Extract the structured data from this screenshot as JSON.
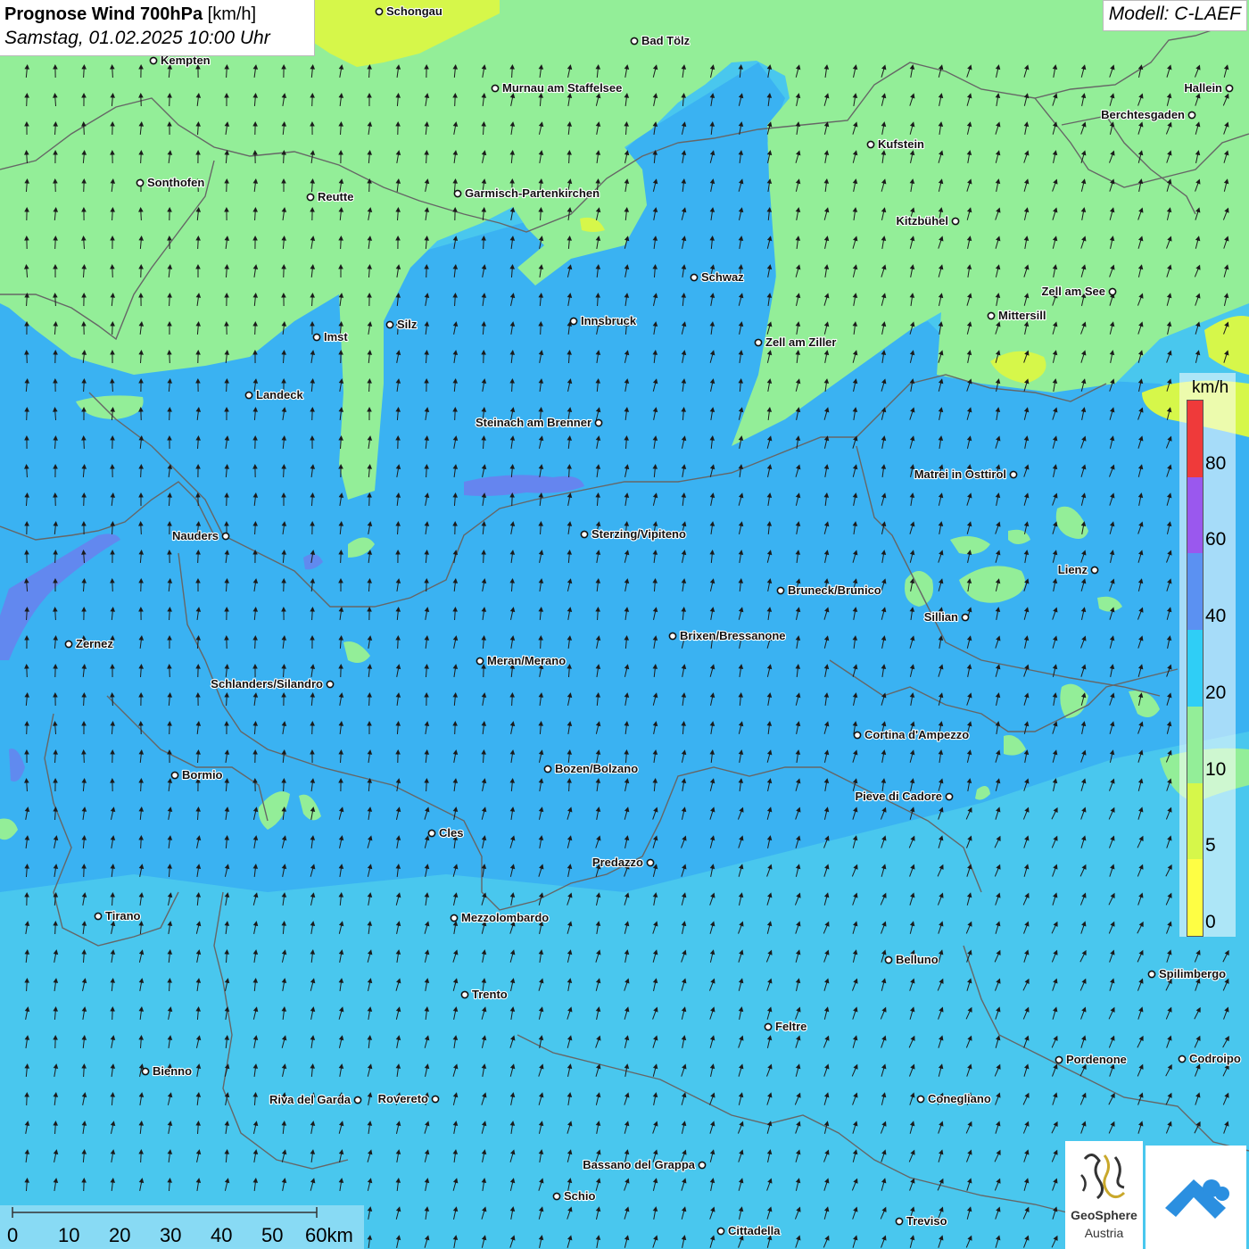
{
  "header": {
    "title": "Prognose Wind 700hPa",
    "unit": "[km/h]",
    "datetime": "Samstag, 01.02.2025 10:00 Uhr",
    "model": "Modell: C-LAEF"
  },
  "legend": {
    "unit": "km/h",
    "bins": [
      {
        "label": "0",
        "color": "#fefe44"
      },
      {
        "label": "5",
        "color": "#d6f74a"
      },
      {
        "label": "10",
        "color": "#93ee98"
      },
      {
        "label": "20",
        "color": "#2fcef6"
      },
      {
        "label": "40",
        "color": "#5b91f2"
      },
      {
        "label": "60",
        "color": "#9a58ee"
      },
      {
        "label": "80",
        "color": "#ef3a3a"
      }
    ]
  },
  "scale_bar": {
    "labels": [
      "0",
      "10",
      "20",
      "30",
      "40",
      "50",
      "60km"
    ]
  },
  "map": {
    "dominant_wind_direction": "from south / south-west",
    "colors": {
      "zone_green": "#93ee98",
      "zone_cyan": "#49c7ee",
      "zone_blue": "#3ab2f2",
      "zone_yellow": "#d6f74a",
      "zone_purple": "#6a80ee",
      "border": "#666666",
      "arrow": "#1b1b1b"
    },
    "cities": [
      {
        "name": "Schongau"
      },
      {
        "name": "Bad Tölz"
      },
      {
        "name": "Kempten"
      },
      {
        "name": "Murnau am Staffelsee"
      },
      {
        "name": "Hallein"
      },
      {
        "name": "Berchtesgaden"
      },
      {
        "name": "Kufstein"
      },
      {
        "name": "Sonthofen"
      },
      {
        "name": "Reutte"
      },
      {
        "name": "Garmisch-Partenkirchen"
      },
      {
        "name": "Kitzbühel"
      },
      {
        "name": "Schwaz"
      },
      {
        "name": "Zell am See"
      },
      {
        "name": "Mittersill"
      },
      {
        "name": "Silz"
      },
      {
        "name": "Innsbruck"
      },
      {
        "name": "Imst"
      },
      {
        "name": "Zell am Ziller"
      },
      {
        "name": "Landeck"
      },
      {
        "name": "Steinach am Brenner"
      },
      {
        "name": "Matrei in Osttirol"
      },
      {
        "name": "Nauders"
      },
      {
        "name": "Sterzing/Vipiteno"
      },
      {
        "name": "Lienz"
      },
      {
        "name": "Bruneck/Brunico"
      },
      {
        "name": "Sillian"
      },
      {
        "name": "Brixen/Bressanone"
      },
      {
        "name": "Zernez"
      },
      {
        "name": "Meran/Merano"
      },
      {
        "name": "Schlanders/Silandro"
      },
      {
        "name": "Cortina d'Ampezzo"
      },
      {
        "name": "Bozen/Bolzano"
      },
      {
        "name": "Bormio"
      },
      {
        "name": "Pieve di Cadore"
      },
      {
        "name": "Cles"
      },
      {
        "name": "Predazzo"
      },
      {
        "name": "Tirano"
      },
      {
        "name": "Mezzolombardo"
      },
      {
        "name": "Belluno"
      },
      {
        "name": "Spilimbergo"
      },
      {
        "name": "Trento"
      },
      {
        "name": "Feltre"
      },
      {
        "name": "Pordenone"
      },
      {
        "name": "Codroipo"
      },
      {
        "name": "Bienno"
      },
      {
        "name": "Riva del Garda"
      },
      {
        "name": "Rovereto"
      },
      {
        "name": "Conegliano"
      },
      {
        "name": "Bassano del Grappa"
      },
      {
        "name": "Schio"
      },
      {
        "name": "Treviso"
      },
      {
        "name": "Cittadella"
      }
    ]
  },
  "logos": {
    "geosphere_line1": "GeoSphere",
    "geosphere_line2": "Austria"
  }
}
